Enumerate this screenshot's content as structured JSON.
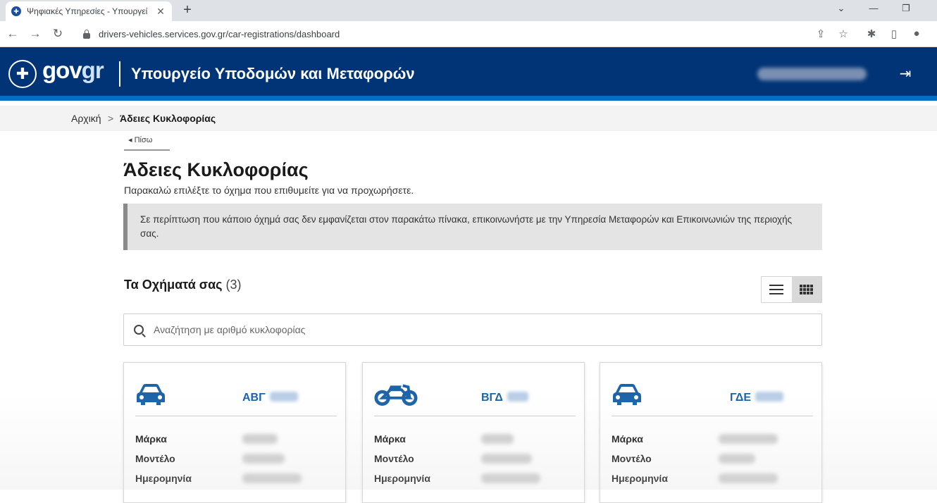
{
  "browser": {
    "tab_title": "Ψηφιακές Υπηρεσίες - Υπουργεί",
    "url": "drivers-vehicles.services.gov.gr/car-registrations/dashboard"
  },
  "header": {
    "logo_gov": "gov",
    "logo_gr": "gr",
    "ministry": "Υπουργείο Υποδομών και Μεταφορών"
  },
  "breadcrumb": {
    "home": "Αρχική",
    "separator": ">",
    "current": "Άδειες Κυκλοφορίας"
  },
  "page": {
    "back_label": "Πίσω",
    "title": "Άδειες Κυκλοφορίας",
    "subtitle": "Παρακαλώ επιλέξτε το όχημα που επιθυμείτε για να προχωρήσετε.",
    "notice": "Σε περίπτωση που κάποιο όχημά σας δεν εμφανίζεται στον παρακάτω πίνακα, επικοινωνήστε με την Υπηρεσία Μεταφορών και Επικοινωνιών της περιοχής σας."
  },
  "vehicles": {
    "title": "Τα Οχήματά σας",
    "count": "(3)",
    "search_placeholder": "Αναζήτηση με αριθμό κυκλοφορίας",
    "labels": {
      "brand": "Μάρκα",
      "model": "Μοντέλο",
      "date": "Ημερομηνία"
    },
    "cards": [
      {
        "plate": "ΑΒΓ",
        "icon": "car-icon"
      },
      {
        "plate": "ΒΓΔ",
        "icon": "motorcycle-icon"
      },
      {
        "plate": "ΓΔΕ",
        "icon": "car-icon"
      }
    ]
  },
  "colors": {
    "header_bg": "#003476",
    "header_stripe": "#046ec5",
    "accent_blue": "#1c63a8"
  }
}
